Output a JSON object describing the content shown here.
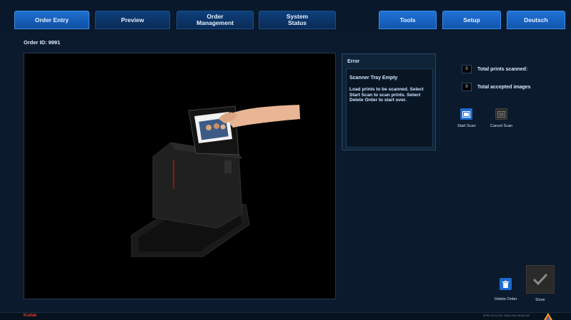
{
  "nav": {
    "tabs": [
      {
        "label": "Order Entry"
      },
      {
        "label": "Preview"
      },
      {
        "label": "Order\nManagement"
      },
      {
        "label": "System\nStatus"
      },
      {
        "label": "Tools"
      },
      {
        "label": "Setup"
      },
      {
        "label": "Deutsch"
      }
    ]
  },
  "order": {
    "id_label": "Order ID: 9991"
  },
  "error": {
    "title": "Error",
    "heading": "Scanner Tray Empty",
    "message": "Load prints to be scanned. Select Start Scan to scan prints. Select Delete Order to start over."
  },
  "counters": {
    "total_scanned_value": "0",
    "total_scanned_label": "Total prints scanned:",
    "total_accepted_value": "0",
    "total_accepted_label": "Total accepted images"
  },
  "actions": {
    "start_scan": "Start Scan",
    "cancel_scan": "Cancel Scan",
    "delete_order": "Delete Order",
    "done": "Done"
  },
  "footer": {
    "brand": "Kodak",
    "build": "APEX V6.0 (T10) · Build: 2014.0918.0149"
  },
  "colors": {
    "accent": "#1d6bd1",
    "background": "#0b1a2c",
    "brand_red": "#e03a2a"
  }
}
